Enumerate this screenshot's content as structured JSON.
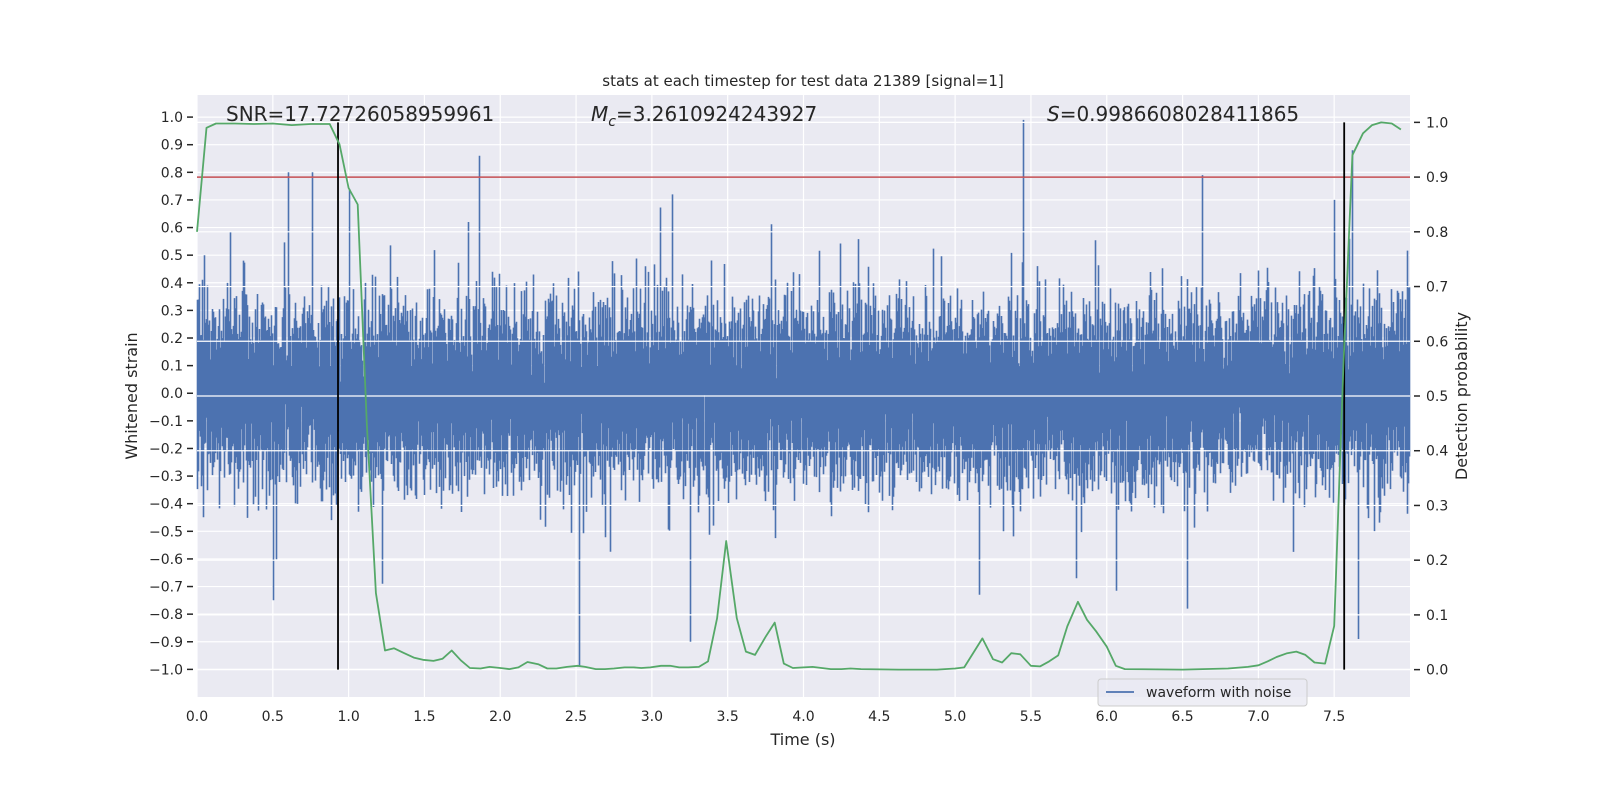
{
  "chart_data": {
    "type": "line",
    "title": "stats at each timestep for test data 21389 [signal=1]",
    "xlabel": "Time (s)",
    "ylabel_left": "Whitened strain",
    "ylabel_right": "Detection probability",
    "xlim": [
      0,
      8
    ],
    "ylim_left": [
      -1.1,
      1.08
    ],
    "ylim_right": [
      -0.05,
      1.05
    ],
    "grid": true,
    "x_ticks": [
      "0.0",
      "0.5",
      "1.0",
      "1.5",
      "2.0",
      "2.5",
      "3.0",
      "3.5",
      "4.0",
      "4.5",
      "5.0",
      "5.5",
      "6.0",
      "6.5",
      "7.0",
      "7.5"
    ],
    "y_ticks_left": [
      "-1.0",
      "-0.9",
      "-0.8",
      "-0.7",
      "-0.6",
      "-0.5",
      "-0.4",
      "-0.3",
      "-0.2",
      "-0.1",
      "0.0",
      "0.1",
      "0.2",
      "0.3",
      "0.4",
      "0.5",
      "0.6",
      "0.7",
      "0.8",
      "0.9",
      "1.0"
    ],
    "y_ticks_right": [
      "0.0",
      "0.1",
      "0.2",
      "0.3",
      "0.4",
      "0.5",
      "0.6",
      "0.7",
      "0.8",
      "0.9",
      "1.0"
    ],
    "annotations": {
      "snr": "SNR=17.72726058959961",
      "mc_symbol": "M",
      "mc_sub": "c",
      "mc_value": "=3.2610924243927",
      "s_symbol": "S",
      "s_value": "=0.9986608028411865"
    },
    "legend": {
      "position": "lower right",
      "entries": [
        {
          "label": "waveform with noise",
          "color": "#4C72B0"
        }
      ]
    },
    "series": [
      {
        "name": "waveform with noise",
        "axis": "left",
        "color": "#4C72B0",
        "kind": "dense noisy strain",
        "notable_peaks": [
          {
            "t": 0.5,
            "v": -0.75
          },
          {
            "t": 0.6,
            "v": 0.8
          },
          {
            "t": 0.76,
            "v": 0.8
          },
          {
            "t": 1.0,
            "v": 0.74
          },
          {
            "t": 1.22,
            "v": -0.69
          },
          {
            "t": 1.86,
            "v": 0.86
          },
          {
            "t": 2.52,
            "v": -0.99
          },
          {
            "t": 3.25,
            "v": -0.9
          },
          {
            "t": 3.13,
            "v": 0.72
          },
          {
            "t": 5.45,
            "v": 0.99
          },
          {
            "t": 5.16,
            "v": -0.73
          },
          {
            "t": 5.8,
            "v": -0.67
          },
          {
            "t": 6.53,
            "v": -0.78
          },
          {
            "t": 6.63,
            "v": 0.79
          },
          {
            "t": 7.62,
            "v": 0.88
          },
          {
            "t": 7.66,
            "v": -0.89
          },
          {
            "t": 7.5,
            "v": 0.7
          }
        ]
      },
      {
        "name": "",
        "axis": "right",
        "color": "#55A868",
        "t": [
          0,
          0.0625,
          0.125,
          0.25,
          0.375,
          0.5,
          0.625,
          0.75,
          0.875,
          0.94,
          1.0,
          1.06,
          1.12,
          1.18,
          1.24,
          1.3,
          1.36,
          1.43,
          1.49,
          1.56,
          1.62,
          1.68,
          1.74,
          1.8,
          1.87,
          1.93,
          2.0,
          2.06,
          2.12,
          2.18,
          2.25,
          2.31,
          2.37,
          2.44,
          2.51,
          2.56,
          2.63,
          2.69,
          2.75,
          2.82,
          2.88,
          2.93,
          2.99,
          3.06,
          3.12,
          3.18,
          3.24,
          3.31,
          3.37,
          3.43,
          3.49,
          3.56,
          3.62,
          3.68,
          3.75,
          3.81,
          3.87,
          3.93,
          4.0,
          4.06,
          4.12,
          4.18,
          4.25,
          4.31,
          4.38,
          4.63,
          4.88,
          5.0,
          5.06,
          5.18,
          5.25,
          5.31,
          5.37,
          5.43,
          5.5,
          5.56,
          5.62,
          5.68,
          5.74,
          5.81,
          5.87,
          5.93,
          6.0,
          6.06,
          6.12,
          6.5,
          6.8,
          6.93,
          7.0,
          7.06,
          7.12,
          7.19,
          7.25,
          7.31,
          7.37,
          7.44,
          7.5,
          7.56,
          7.62,
          7.69,
          7.75,
          7.81,
          7.88,
          7.94
        ],
        "p": [
          0.8,
          0.99,
          0.998,
          0.998,
          0.997,
          0.998,
          0.995,
          0.997,
          0.997,
          0.96,
          0.88,
          0.85,
          0.45,
          0.14,
          0.035,
          0.039,
          0.031,
          0.022,
          0.018,
          0.016,
          0.02,
          0.035,
          0.017,
          0.003,
          0.002,
          0.005,
          0.003,
          0.001,
          0.004,
          0.014,
          0.01,
          0.002,
          0.002,
          0.005,
          0.007,
          0.005,
          0.001,
          0.001,
          0.002,
          0.004,
          0.004,
          0.003,
          0.004,
          0.007,
          0.007,
          0.004,
          0.004,
          0.005,
          0.015,
          0.094,
          0.235,
          0.094,
          0.033,
          0.027,
          0.06,
          0.086,
          0.011,
          0.003,
          0.004,
          0.005,
          0.003,
          0.001,
          0.001,
          0.002,
          0.001,
          0.0,
          0.0,
          0.002,
          0.004,
          0.057,
          0.019,
          0.013,
          0.03,
          0.028,
          0.007,
          0.006,
          0.015,
          0.026,
          0.079,
          0.124,
          0.091,
          0.07,
          0.042,
          0.007,
          0.001,
          0.0,
          0.002,
          0.005,
          0.008,
          0.015,
          0.023,
          0.03,
          0.033,
          0.027,
          0.013,
          0.011,
          0.08,
          0.55,
          0.94,
          0.98,
          0.995,
          1.0,
          0.998,
          0.987
        ]
      }
    ],
    "threshold_line": {
      "axis": "right",
      "value": 0.9,
      "color": "#C44E52"
    },
    "vertical_lines": {
      "axis": "right",
      "t": [
        0.93,
        7.566
      ],
      "from": 0,
      "to": 1,
      "color": "#000000"
    }
  }
}
